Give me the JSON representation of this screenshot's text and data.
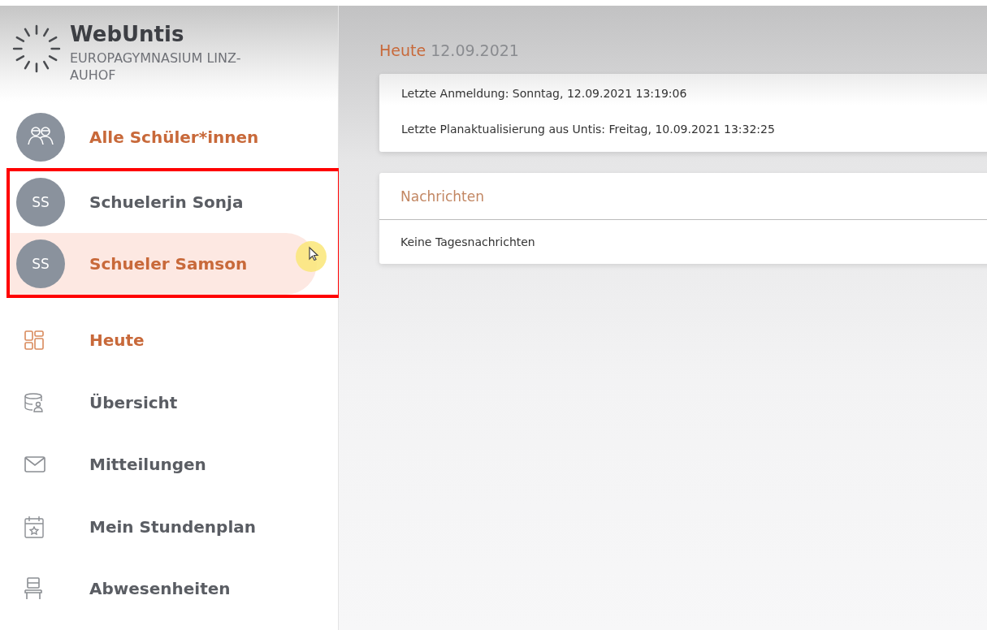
{
  "app": {
    "title": "WebUntis",
    "school": "EUROPAGYMNASIUM LINZ-AUHOF"
  },
  "students": [
    {
      "kind": "group",
      "label": "Alle Schüler*innen",
      "selected": false,
      "framed": false
    },
    {
      "kind": "person",
      "initials": "SS",
      "label": "Schuelerin Sonja",
      "selected": false,
      "framed": true
    },
    {
      "kind": "person",
      "initials": "SS",
      "label": "Schueler Samson",
      "selected": true,
      "framed": true
    }
  ],
  "nav": [
    {
      "kind": "grid",
      "label": "Heute",
      "selected": true
    },
    {
      "kind": "database",
      "label": "Übersicht",
      "selected": false
    },
    {
      "kind": "mail",
      "label": "Mitteilungen",
      "selected": false
    },
    {
      "kind": "calendar",
      "label": "Mein Stundenplan",
      "selected": false
    },
    {
      "kind": "chair",
      "label": "Abwesenheiten",
      "selected": false
    }
  ],
  "main": {
    "heading": "Heute",
    "date": "12.09.2021",
    "info": [
      "Letzte Anmeldung: Sonntag, 12.09.2021 13:19:06",
      "Letzte Planaktualisierung aus Untis: Freitag, 10.09.2021 13:32:25"
    ],
    "messages": {
      "title": "Nachrichten",
      "text": "Keine Tagesnachrichten"
    }
  }
}
